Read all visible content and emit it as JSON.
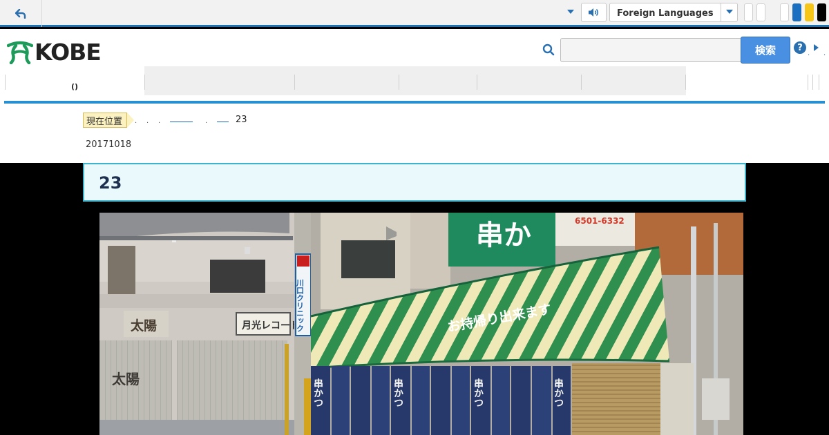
{
  "toolbar": {
    "language_label": "Foreign Languages"
  },
  "header": {
    "logo_text": "KOBE",
    "search": {
      "placeholder": "",
      "button_label": "検索"
    }
  },
  "nav": {
    "active_label": "()"
  },
  "breadcrumb": {
    "label": "現在位置",
    "current": "23"
  },
  "page": {
    "date": "20171018",
    "title": "23"
  },
  "photo": {
    "signs": {
      "awning_text": "お持帰り出来ます",
      "shop_sign": "串か",
      "clinic_sign": "川口クリニック",
      "taiyo_sign": "太陽",
      "record_sign": "月光レコード",
      "phone": "6501-6332",
      "noren_text": "串かつ"
    }
  },
  "colors": {
    "accent": "#1a73b5",
    "nav_line": "#2a8fd0",
    "search_button": "#4a90e2",
    "title_border": "#3fb3cc",
    "title_bg": "#eafafc",
    "logo_green": "#1e9b5a",
    "swatch_blue": "#1a6fc0",
    "swatch_yellow": "#f5c518",
    "swatch_black": "#000000"
  },
  "icons": [
    "back-arrow-icon",
    "speaker-icon",
    "search-icon",
    "help-icon",
    "chevron-right-icon",
    "kobe-emblem-icon"
  ]
}
